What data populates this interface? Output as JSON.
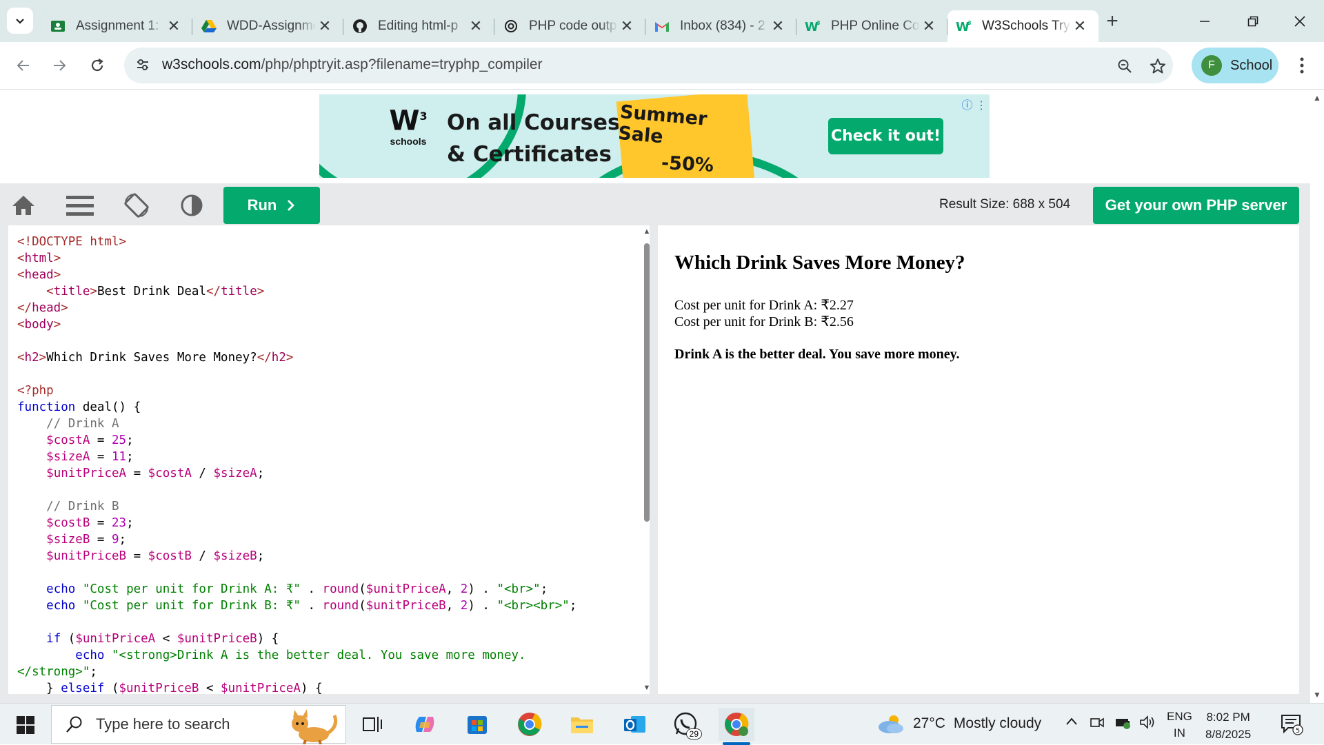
{
  "browser": {
    "tabs": [
      {
        "title": "Assignment 1:",
        "icon": "google-classroom-icon",
        "active": false
      },
      {
        "title": "WDD-Assignment",
        "icon": "google-drive-icon",
        "active": false
      },
      {
        "title": "Editing html-p",
        "icon": "github-icon",
        "active": false
      },
      {
        "title": "PHP code outp",
        "icon": "chatgpt-icon",
        "active": false
      },
      {
        "title": "Inbox (834) - 2",
        "icon": "gmail-icon",
        "active": false
      },
      {
        "title": "PHP Online Co",
        "icon": "w3schools-icon",
        "active": false
      },
      {
        "title": "W3Schools Try",
        "icon": "w3schools-icon",
        "active": true
      }
    ],
    "url_domain": "w3schools.com",
    "url_path": "/php/phptryit.asp?filename=tryphp_compiler",
    "profile_initial": "F",
    "profile_name": "School"
  },
  "ad": {
    "logo_text": "W",
    "logo_sup": "3",
    "logo_sub": "schools",
    "headline_1": "On all Courses",
    "headline_2": "& Certificates",
    "sale_1": "Summer Sale",
    "sale_2": "-50%",
    "cta": "Check it out!"
  },
  "tryit": {
    "run_label": "Run",
    "result_size": "Result Size: 688 x 504",
    "get_server": "Get your own PHP server"
  },
  "code_lines": [
    "<!DOCTYPE html>",
    "<html>",
    "<head>",
    "    <title>Best Drink Deal</title>",
    "</head>",
    "<body>",
    "",
    "<h2>Which Drink Saves More Money?</h2>",
    "",
    "<?php",
    "function deal() {",
    "    // Drink A",
    "    $costA = 25;",
    "    $sizeA = 11;",
    "    $unitPriceA = $costA / $sizeA;",
    "",
    "    // Drink B",
    "    $costB = 23;",
    "    $sizeB = 9;",
    "    $unitPriceB = $costB / $sizeB;",
    "",
    "    echo \"Cost per unit for Drink A: ₹\" . round($unitPriceA, 2) . \"<br>\";",
    "    echo \"Cost per unit for Drink B: ₹\" . round($unitPriceB, 2) . \"<br><br>\";",
    "",
    "    if ($unitPriceA < $unitPriceB) {",
    "        echo \"<strong>Drink A is the better deal. You save more money.",
    "</strong>\";",
    "    } elseif ($unitPriceB < $unitPriceA) {"
  ],
  "result": {
    "heading": "Which Drink Saves More Money?",
    "line_a": "Cost per unit for Drink A: ₹2.27",
    "line_b": "Cost per unit for Drink B: ₹2.56",
    "verdict": "Drink A is the better deal. You save more money."
  },
  "taskbar": {
    "search_placeholder": "Type here to search",
    "whatsapp_badge": "29",
    "weather_temp": "27°C",
    "weather_cond": "Mostly cloudy",
    "lang_1": "ENG",
    "lang_2": "IN",
    "time": "8:02 PM",
    "date": "8/8/2025",
    "notif_count": "5"
  },
  "colors": {
    "accent_green": "#04aa6d",
    "tabstrip": "#dee9ea",
    "omnibox": "#e9f1f2"
  }
}
